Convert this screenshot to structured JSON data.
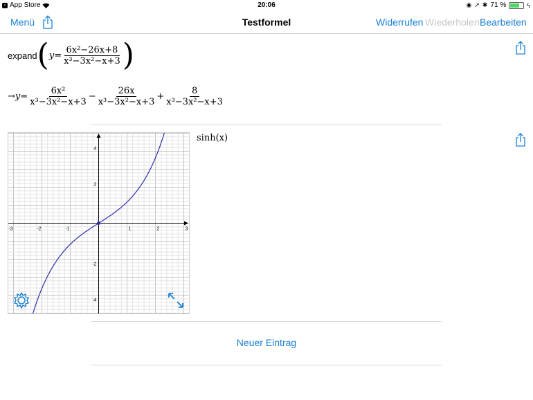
{
  "status_bar": {
    "back_app": "App Store",
    "time": "20:06",
    "battery": "71 %",
    "battery_level": 0.71
  },
  "navbar": {
    "menu": "Menü",
    "title": "Testformel",
    "undo": "Widerrufen",
    "redo": "Wiederholen",
    "edit": "Bearbeiten"
  },
  "entry1": {
    "func": "expand",
    "input": {
      "lhs": "y",
      "num": "6x²−26x+8",
      "den": "x³−3x²−x+3"
    },
    "output": {
      "arrow": "→",
      "lhs": "y",
      "terms": [
        {
          "op": "",
          "num": "6x²",
          "den": "x³−3x²−x+3"
        },
        {
          "op": "−",
          "num": "26x",
          "den": "x³−3x²−x+3"
        },
        {
          "op": "+",
          "num": "8",
          "den": "x³−3x²−x+3"
        }
      ]
    }
  },
  "entry2": {
    "expression": "sinh(x)",
    "chart_data": {
      "type": "line",
      "function": "sinh(x)",
      "xlim": [
        -3,
        3
      ],
      "ylim": [
        -5,
        5
      ],
      "x_ticks": [
        "-3",
        "-2",
        "-1",
        "1",
        "2",
        "3"
      ],
      "y_ticks": [
        "4",
        "2",
        "-2",
        "-4"
      ],
      "grid": true,
      "series": [
        {
          "values": "y = sinh(x)",
          "color": "#2b2ea8"
        }
      ]
    }
  },
  "new_entry": "Neuer Eintrag",
  "colors": {
    "accent": "#1a7fd6",
    "curve": "#2b2ea8"
  }
}
